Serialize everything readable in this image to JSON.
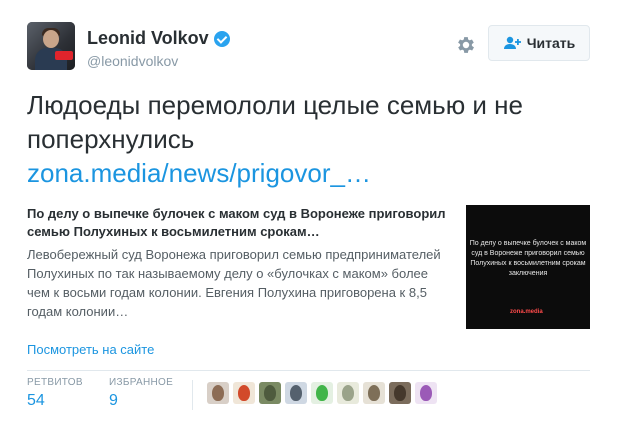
{
  "author": {
    "name": "Leonid Volkov",
    "handle": "@leonidvolkov",
    "verified": true
  },
  "actions": {
    "follow_label": "Читать",
    "settings_icon": "gear-icon",
    "follow_icon": "add-user-icon"
  },
  "tweet": {
    "text": "Людоеды перемололи целые семью и не поперхнулись",
    "link": "zona.media/news/prigovor_…"
  },
  "card": {
    "title": "По делу о выпечке булочек с маком суд в Воронеже приговорил семью Полухиных к восьмилетним срокам…",
    "description": "Левобережный суд Воронежа приговорил семью предпринимателей Полухиных по так называемому делу о «булочках с маком» более чем к восьми годам колонии. Евгения Полухина приговорена к 8,5 годам колонии…",
    "thumb_text": "По делу о выпечке булочек с маком суд в Воронеже приговорил семью Полухиных к восьмилетним срокам заключения",
    "thumb_logo": "zona.media"
  },
  "view_on_site": "Посмотреть на сайте",
  "stats": {
    "retweets_label": "РЕТВИТОВ",
    "retweets_value": "54",
    "favorites_label": "ИЗБРАННОЕ",
    "favorites_value": "9"
  },
  "colors": {
    "link": "#1b95e0",
    "verified": "#2aa3ef",
    "text": "#292f33",
    "muted": "#8899a6"
  },
  "favoriters": [
    {
      "bg": "#d8cfc7",
      "fg": "#8c6c55"
    },
    {
      "bg": "#f0e6d8",
      "fg": "#d24a2a"
    },
    {
      "bg": "#7a8a63",
      "fg": "#4e5b3e"
    },
    {
      "bg": "#cfd8e3",
      "fg": "#55616e"
    },
    {
      "bg": "#e4f0e2",
      "fg": "#42b54a"
    },
    {
      "bg": "#e8eadc",
      "fg": "#9aa38a"
    },
    {
      "bg": "#e6e1d6",
      "fg": "#7e6f58"
    },
    {
      "bg": "#7b6c5c",
      "fg": "#45382c"
    },
    {
      "bg": "#eee3f3",
      "fg": "#9b5ab7"
    }
  ]
}
